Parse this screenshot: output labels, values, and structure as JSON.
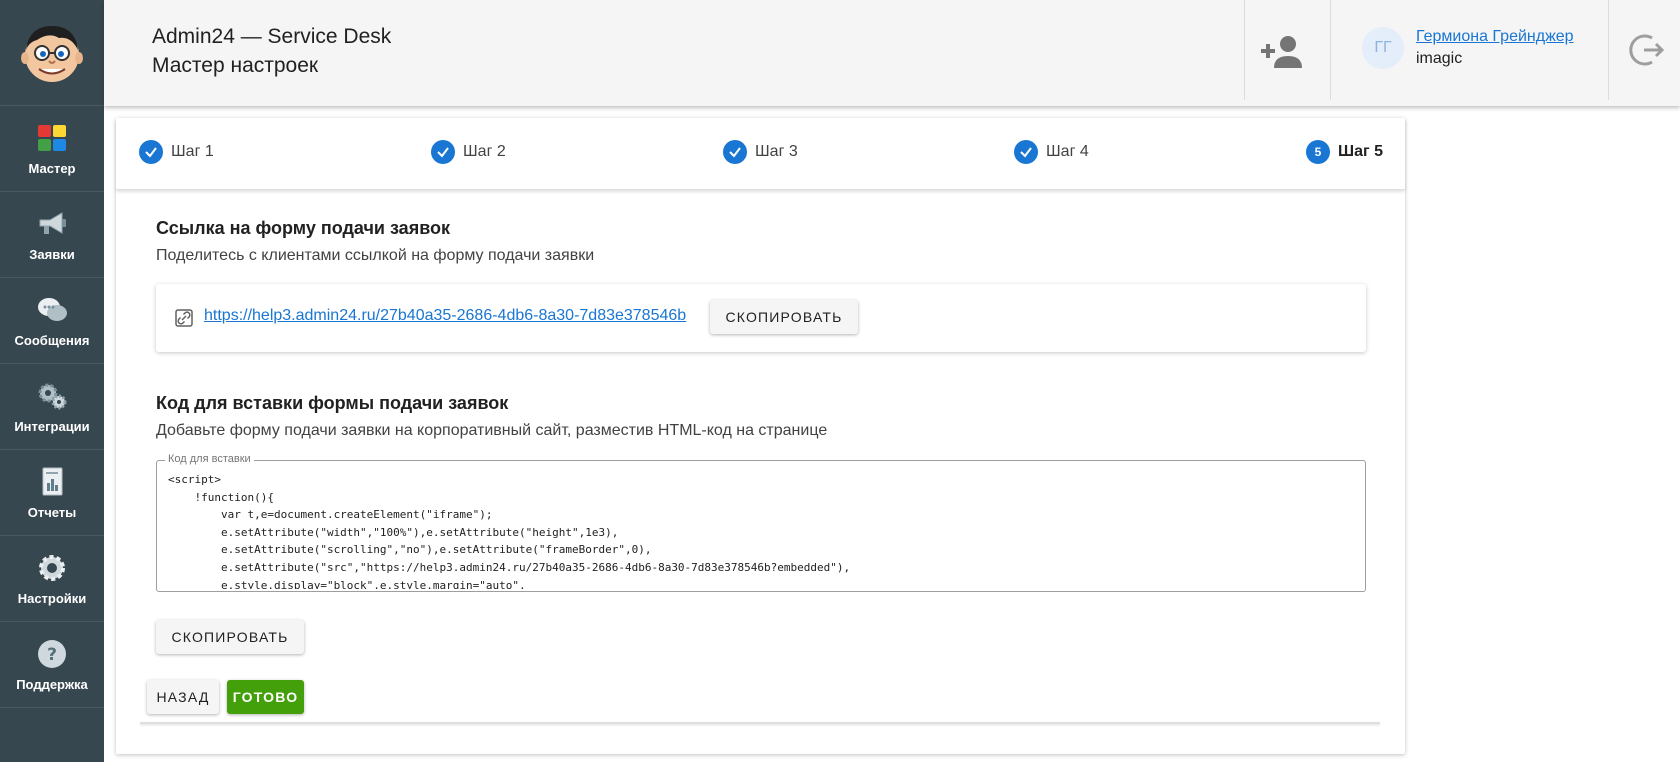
{
  "header": {
    "title": "Admin24 — Service Desk",
    "subtitle": "Мастер настроек"
  },
  "user": {
    "initials": "ГГ",
    "name": "Гермиона Грейнджер",
    "org": "imagic"
  },
  "sidebar": {
    "items": [
      {
        "label": "Мастер",
        "icon": "blocks-icon"
      },
      {
        "label": "Заявки",
        "icon": "megaphone-icon"
      },
      {
        "label": "Сообщения",
        "icon": "chat-icon"
      },
      {
        "label": "Интеграции",
        "icon": "gears-icon"
      },
      {
        "label": "Отчеты",
        "icon": "report-icon"
      },
      {
        "label": "Настройки",
        "icon": "gear-icon"
      },
      {
        "label": "Поддержка",
        "icon": "question-icon"
      }
    ]
  },
  "stepper": {
    "steps": [
      {
        "label": "Шаг 1",
        "state": "done"
      },
      {
        "label": "Шаг 2",
        "state": "done"
      },
      {
        "label": "Шаг 3",
        "state": "done"
      },
      {
        "label": "Шаг 4",
        "state": "done"
      },
      {
        "label": "Шаг 5",
        "state": "active",
        "number": "5"
      }
    ]
  },
  "link_section": {
    "title": "Ссылка на форму подачи заявок",
    "description": "Поделитесь с клиентами ссылкой на форму подачи заявки",
    "url": "https://help3.admin24.ru/27b40a35-2686-4db6-8a30-7d83e378546b",
    "copy_label": "Скопировать"
  },
  "code_section": {
    "title": "Код для вставки формы подачи заявок",
    "description": "Добавьте форму подачи заявки на корпоративный сайт, разместив HTML-код на странице",
    "field_label": "Код для вставки",
    "code": "<script>\n    !function(){\n        var t,e=document.createElement(\"iframe\");\n        e.setAttribute(\"width\",\"100%\"),e.setAttribute(\"height\",1e3),\n        e.setAttribute(\"scrolling\",\"no\"),e.setAttribute(\"frameBorder\",0),\n        e.setAttribute(\"src\",\"https://help3.admin24.ru/27b40a35-2686-4db6-8a30-7d83e378546b?embedded\"),\n        e.style.display=\"block\",e.style.margin=\"auto\",",
    "copy_label": "Скопировать"
  },
  "actions": {
    "back_label": "Назад",
    "done_label": "Готово"
  },
  "colors": {
    "sidebar_bg": "#37474f",
    "accent": "#1976d2",
    "success": "#43a00a"
  }
}
